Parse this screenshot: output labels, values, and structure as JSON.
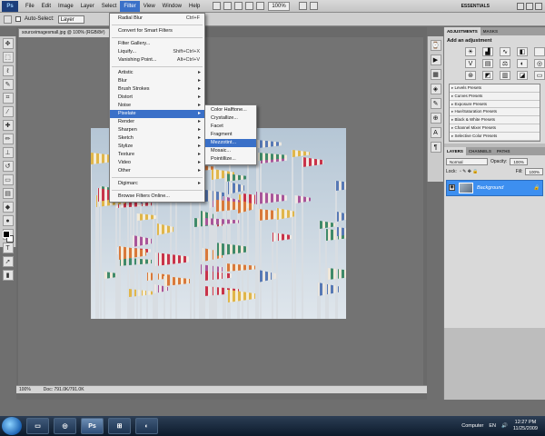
{
  "menubar": {
    "logo": "Ps",
    "items": [
      "File",
      "Edit",
      "Image",
      "Layer",
      "Select",
      "Filter",
      "View",
      "Window",
      "Help"
    ],
    "zoom": "100%",
    "workspace": "ESSENTIALS"
  },
  "options": {
    "auto_select": "Auto-Select:",
    "target": "Layer"
  },
  "document": {
    "tab": "sourceimagesmall.jpg @ 100% (RGB/8#)",
    "status_zoom": "100%",
    "status_doc": "Doc: 791.0K/791.0K"
  },
  "filter_menu": {
    "items": [
      {
        "label": "Radial Blur",
        "shortcut": "Ctrl+F"
      },
      {
        "sep": true
      },
      {
        "label": "Convert for Smart Filters"
      },
      {
        "sep": true
      },
      {
        "label": "Filter Gallery..."
      },
      {
        "label": "Liquify...",
        "shortcut": "Shift+Ctrl+X"
      },
      {
        "label": "Vanishing Point...",
        "shortcut": "Alt+Ctrl+V"
      },
      {
        "sep": true
      },
      {
        "label": "Artistic",
        "sub": true
      },
      {
        "label": "Blur",
        "sub": true
      },
      {
        "label": "Brush Strokes",
        "sub": true
      },
      {
        "label": "Distort",
        "sub": true
      },
      {
        "label": "Noise",
        "sub": true
      },
      {
        "label": "Pixelate",
        "sub": true,
        "highlight": true
      },
      {
        "label": "Render",
        "sub": true
      },
      {
        "label": "Sharpen",
        "sub": true
      },
      {
        "label": "Sketch",
        "sub": true
      },
      {
        "label": "Stylize",
        "sub": true
      },
      {
        "label": "Texture",
        "sub": true
      },
      {
        "label": "Video",
        "sub": true
      },
      {
        "label": "Other",
        "sub": true
      },
      {
        "sep": true
      },
      {
        "label": "Digimarc",
        "sub": true
      },
      {
        "sep": true
      },
      {
        "label": "Browse Filters Online..."
      }
    ]
  },
  "pixelate_menu": {
    "items": [
      {
        "label": "Color Halftone..."
      },
      {
        "label": "Crystallize..."
      },
      {
        "label": "Facet"
      },
      {
        "label": "Fragment"
      },
      {
        "label": "Mezzotint...",
        "highlight": true
      },
      {
        "label": "Mosaic..."
      },
      {
        "label": "Pointillize..."
      }
    ]
  },
  "adjustments": {
    "tabs": [
      "ADJUSTMENTS",
      "MASKS"
    ],
    "title": "Add an adjustment",
    "presets": [
      "Levels Presets",
      "Curves Presets",
      "Exposure Presets",
      "Hue/Saturation Presets",
      "Black & White Presets",
      "Channel Mixer Presets",
      "Selective Color Presets"
    ]
  },
  "layers": {
    "tabs": [
      "LAYERS",
      "CHANNELS",
      "PATHS"
    ],
    "blend_mode": "Normal",
    "opacity_label": "Opacity:",
    "opacity": "100%",
    "lock_label": "Lock:",
    "fill_label": "Fill:",
    "fill": "100%",
    "layer_name": "Background"
  },
  "taskbar": {
    "ps_label": "Ps",
    "computer": "Computer",
    "lang": "EN",
    "time": "12:27 PM",
    "date": "11/25/2009"
  },
  "colors": {
    "highlight": "#3a70c8",
    "layer_selected": "#3d8ff0"
  }
}
